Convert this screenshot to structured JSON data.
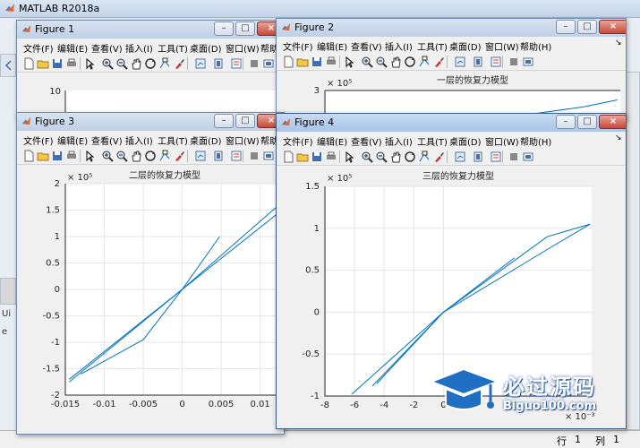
{
  "matlab": {
    "title": "MATLAB R2018a",
    "status_row_label": "行",
    "status_row_value": "1",
    "status_col_label": "列",
    "status_col_value": "1",
    "side_fragment_1": "Ui",
    "side_fragment_2": "e"
  },
  "figure_menu": [
    "文件(F)",
    "编辑(E)",
    "查看(V)",
    "插入(I)",
    "工具(T)",
    "桌面(D)",
    "窗口(W)",
    "帮助(H)"
  ],
  "figure_menu_truncated_last": "帮助",
  "figures": {
    "fig1": {
      "title": "Figure 1",
      "ytick_top": "10"
    },
    "fig2": {
      "title": "Figure 2",
      "plot_title": "一层的恢复力模型",
      "ytick_top": "3",
      "exp": "× 10⁵"
    },
    "fig3": {
      "title": "Figure 3",
      "plot_title": "二层的恢复力模型",
      "exp": "× 10⁵"
    },
    "fig4": {
      "title": "Figure 4",
      "plot_title": "三层的恢复力模型",
      "exp": "× 10⁵",
      "xexp": "× 10⁻³"
    }
  },
  "toolbar_icons": [
    "new-file-icon",
    "open-folder-icon",
    "save-icon",
    "print-icon",
    "arrow-pointer-icon",
    "zoom-in-icon",
    "zoom-out-icon",
    "pan-hand-icon",
    "rotate-3d-icon",
    "data-cursor-icon",
    "brush-icon",
    "link-plot-icon",
    "colorbar-icon",
    "legend-icon",
    "hide-plot-tools-icon",
    "show-plot-tools-icon"
  ],
  "line_color": "#0072bd",
  "chart_data": [
    {
      "type": "line",
      "title": "二层的恢复力模型",
      "y_multiplier": "× 10⁵",
      "xlim": [
        -0.015,
        0.0128
      ],
      "ylim": [
        -2,
        2
      ],
      "xticks": [
        "-0.015",
        "-0.01",
        "-0.005",
        "0",
        "0.005",
        "0.01"
      ],
      "xtick_values": [
        -0.015,
        -0.01,
        -0.005,
        0,
        0.005,
        0.01
      ],
      "yticks": [
        "-2",
        "-1.5",
        "-1",
        "-0.5",
        "0",
        "0.5",
        "1",
        "1.5",
        "2"
      ],
      "ytick_values": [
        -2,
        -1.5,
        -1,
        -0.5,
        0,
        0.5,
        1,
        1.5,
        2
      ],
      "grid": true,
      "series": [
        {
          "x": [
            -0.0145,
            0,
            0.0128
          ],
          "y": [
            -1.75,
            0,
            1.65
          ]
        },
        {
          "x": [
            -0.013,
            -0.005,
            0,
            0.0128
          ],
          "y": [
            -1.6,
            -0.95,
            0,
            1.5
          ]
        },
        {
          "x": [
            -0.0145,
            0,
            0.0048
          ],
          "y": [
            -1.7,
            0,
            1.0
          ]
        }
      ]
    },
    {
      "type": "line",
      "title": "三层的恢复力模型",
      "y_multiplier": "× 10⁵",
      "x_multiplier": "× 10⁻³",
      "xlim": [
        -8,
        10
      ],
      "ylim": [
        -1,
        1.5
      ],
      "xticks": [
        "-8",
        "-6",
        "-4",
        "-2",
        "0"
      ],
      "xtick_values": [
        -8,
        -6,
        -4,
        -2,
        0
      ],
      "yticks": [
        "-1",
        "-0.5",
        "0",
        "0.5",
        "1",
        "1.5"
      ],
      "ytick_values": [
        -1,
        -0.5,
        0,
        0.5,
        1,
        1.5
      ],
      "grid": true,
      "series": [
        {
          "x": [
            -6.2,
            0,
            7.5,
            9.9
          ],
          "y": [
            -0.98,
            0,
            0.8,
            1.05
          ]
        },
        {
          "x": [
            -4.8,
            0,
            7.0,
            9.9
          ],
          "y": [
            -0.88,
            0,
            0.9,
            1.05
          ]
        },
        {
          "x": [
            -4.5,
            0,
            4.8
          ],
          "y": [
            -0.85,
            0,
            0.65
          ]
        }
      ]
    },
    {
      "type": "line",
      "title": "一层的恢复力模型",
      "y_multiplier": "× 10⁵",
      "xlim": [
        0,
        1
      ],
      "ylim": [
        2.6,
        3
      ],
      "yticks": [
        "3"
      ],
      "ytick_values": [
        3
      ],
      "grid": true,
      "series": [
        {
          "x": [
            0.62,
            0.88,
            0.99
          ],
          "y": [
            2.8,
            2.88,
            2.93
          ]
        }
      ]
    }
  ],
  "watermark": {
    "cn": "必过源码",
    "en": "Biguo100.com"
  }
}
